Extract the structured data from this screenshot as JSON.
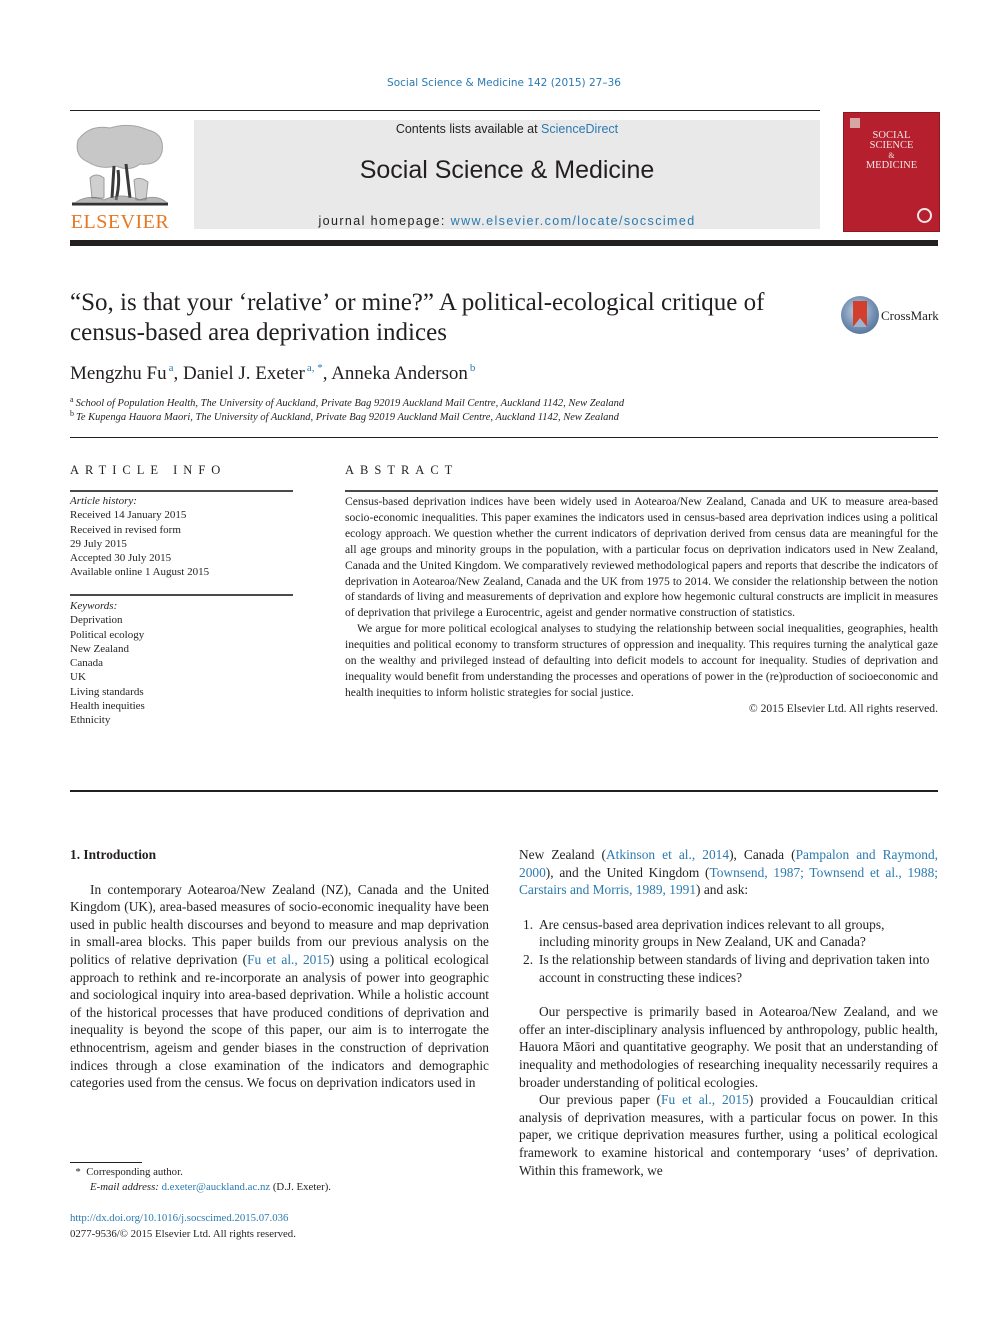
{
  "header": {
    "journal_reference": "Social Science & Medicine 142 (2015) 27–36",
    "publisher_logo_text": "ELSEVIER",
    "contents_prefix": "Contents lists available at ",
    "contents_link": "ScienceDirect",
    "journal_name": "Social Science & Medicine",
    "homepage_prefix": "journal homepage: ",
    "homepage_link": "www.elsevier.com/locate/socscimed",
    "cover_title_lines": [
      "SOCIAL",
      "SCIENCE",
      "&",
      "MEDICINE"
    ]
  },
  "article": {
    "title": "“So, is that your ‘relative’ or mine?” A political-ecological critique of census-based area deprivation indices",
    "crossmark_label": "CrossMark",
    "authors": [
      {
        "name": "Mengzhu Fu",
        "sup": "a"
      },
      {
        "name": "Daniel J. Exeter",
        "sup": "a, *"
      },
      {
        "name": "Anneka Anderson",
        "sup": "b"
      }
    ],
    "affiliations": [
      {
        "mark": "a",
        "text": "School of Population Health, The University of Auckland, Private Bag 92019 Auckland Mail Centre, Auckland 1142, New Zealand"
      },
      {
        "mark": "b",
        "text": "Te Kupenga Hauora Maori, The University of Auckland, Private Bag 92019 Auckland Mail Centre, Auckland 1142, New Zealand"
      }
    ]
  },
  "article_info": {
    "heading": "ARTICLE INFO",
    "history_label": "Article history:",
    "history": [
      "Received 14 January 2015",
      "Received in revised form",
      "29 July 2015",
      "Accepted 30 July 2015",
      "Available online 1 August 2015"
    ],
    "keywords_label": "Keywords:",
    "keywords": [
      "Deprivation",
      "Political ecology",
      "New Zealand",
      "Canada",
      "UK",
      "Living standards",
      "Health inequities",
      "Ethnicity"
    ]
  },
  "abstract": {
    "heading": "ABSTRACT",
    "paragraphs": [
      "Census-based deprivation indices have been widely used in Aotearoa/New Zealand, Canada and UK to measure area-based socio-economic inequalities. This paper examines the indicators used in census-based area deprivation indices using a political ecology approach. We question whether the current indicators of deprivation derived from census data are meaningful for the all age groups and minority groups in the population, with a particular focus on deprivation indicators used in New Zealand, Canada and the United Kingdom. We comparatively reviewed methodological papers and reports that describe the indicators of deprivation in Aotearoa/New Zealand, Canada and the UK from 1975 to 2014. We consider the relationship between the notion of standards of living and measurements of deprivation and explore how hegemonic cultural constructs are implicit in measures of deprivation that privilege a Eurocentric, ageist and gender normative construction of statistics.",
      "We argue for more political ecological analyses to studying the relationship between social in­equalities, geographies, health inequities and political economy to transform structures of oppression and inequality. This requires turning the analytical gaze on the wealthy and privileged instead of defaulting into deficit models to account for inequality. Studies of deprivation and inequality would benefit from understanding the processes and operations of power in the (re)production of socio­economic and health inequities to inform holistic strategies for social justice."
    ],
    "copyright": "© 2015 Elsevier Ltd. All rights reserved."
  },
  "body": {
    "section_heading": "1.  Introduction",
    "left_paragraph": {
      "part1": "In contemporary Aotearoa/New Zealand (NZ), Canada and the United Kingdom (UK), area-based measures of socio-economic inequality have been used in public health discourses and beyond to measure and map deprivation in small-area blocks. This paper builds from our previous analysis on the politics of relative depri­vation (",
      "cite1": "Fu et al., 2015",
      "part2": ") using a political ecological approach to re­think and re-incorporate an analysis of power into geographic and sociological inquiry into area-based deprivation. While a ho­listic account of the historical processes that have produced con­ditions of deprivation and inequality is beyond the scope of this paper, our aim is to interrogate the ethnocentrism, ageism and gender biases in the construction of deprivation indices through a close examination of the indicators and demographic categories used from the census. We focus on deprivation indicators used in"
    },
    "right_intro": {
      "part1": "New Zealand (",
      "cite1": "Atkinson et al., 2014",
      "part2": "), Canada (",
      "cite2": "Pampalon and Raymond, 2000",
      "part3": "), and the United Kingdom (",
      "cite3": "Townsend, 1987; Townsend et al., 1988; Carstairs and Morris, 1989, 1991",
      "part4": ") and ask:"
    },
    "questions": [
      {
        "num": "1.",
        "text": "Are census-based area deprivation indices relevant to all groups, including minority groups in New Zealand, UK and Canada?"
      },
      {
        "num": "2.",
        "text": "Is the relationship between standards of living and deprivation taken into account in constructing these indices?"
      }
    ],
    "right_paragraph2": "Our perspective is primarily based in Aotearoa/New Zealand, and we offer an inter-disciplinary analysis influenced by anthro­pology, public health, Hauora Māori and quantitative geography. We posit that an understanding of inequality and methodologies of researching inequality necessarily requires a broader understand­ing of political ecologies.",
    "right_paragraph3": {
      "part1": "Our previous paper (",
      "cite1": "Fu et al., 2015",
      "part2": ") provided a Foucauldian critical analysis of deprivation measures, with a particular focus on power. In this paper, we critique deprivation measures further, using a political ecological framework to examine historical and contemporary ‘uses’ of deprivation. Within this framework, we"
    }
  },
  "footer": {
    "corresponding_mark": "*",
    "corresponding_text": "Corresponding author.",
    "email_label": "E-mail address:",
    "email": "d.exeter@auckland.ac.nz",
    "email_suffix": " (D.J. Exeter).",
    "doi": "http://dx.doi.org/10.1016/j.socscimed.2015.07.036",
    "issn_copyright": "0277-9536/© 2015 Elsevier Ltd. All rights reserved."
  },
  "colors": {
    "link": "#2a7ab0",
    "elsevier_orange": "#e87722",
    "cover_red": "#b51f2e",
    "banner_gray": "#e9e9e9"
  }
}
